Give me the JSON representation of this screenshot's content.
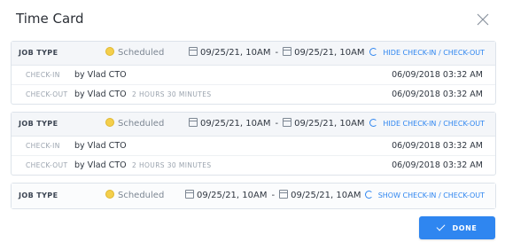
{
  "modal": {
    "title": "Time Card",
    "done_label": "DONE"
  },
  "cards": [
    {
      "job_type": "JOB TYPE",
      "status": "Scheduled",
      "start": "09/25/21, 10AM",
      "separator": "-",
      "end": "09/25/21, 10AM",
      "toggle_label": "HIDE CHECK-IN / CHECK-OUT",
      "checkin": {
        "label": "CHECK-IN",
        "by": "by  Vlad CTO",
        "time": "06/09/2018 03:32 AM"
      },
      "checkout": {
        "label": "CHECK-OUT",
        "by": "by  Vlad CTO",
        "duration": "2 HOURS 30 MINUTES",
        "time": "06/09/2018 03:32 AM"
      }
    },
    {
      "job_type": "JOB TYPE",
      "status": "Scheduled",
      "start": "09/25/21, 10AM",
      "separator": "-",
      "end": "09/25/21, 10AM",
      "toggle_label": "HIDE CHECK-IN / CHECK-OUT",
      "checkin": {
        "label": "CHECK-IN",
        "by": "by  Vlad CTO",
        "time": "06/09/2018 03:32 AM"
      },
      "checkout": {
        "label": "CHECK-OUT",
        "by": "by  Vlad CTO",
        "duration": "2 HOURS 30 MINUTES",
        "time": "06/09/2018 03:32 AM"
      }
    },
    {
      "job_type": "JOB TYPE",
      "status": "Scheduled",
      "start": "09/25/21, 10AM",
      "separator": "-",
      "end": "09/25/21, 10AM",
      "toggle_label": "SHOW CHECK-IN / CHECK-OUT"
    }
  ],
  "colors": {
    "accent": "#2f86f0",
    "status_dot": "#f4cf4c",
    "muted": "#9aa3ae"
  },
  "icons": {
    "close": "close-icon",
    "calendar": "calendar-icon",
    "refresh": "refresh-icon",
    "check": "check-icon"
  }
}
